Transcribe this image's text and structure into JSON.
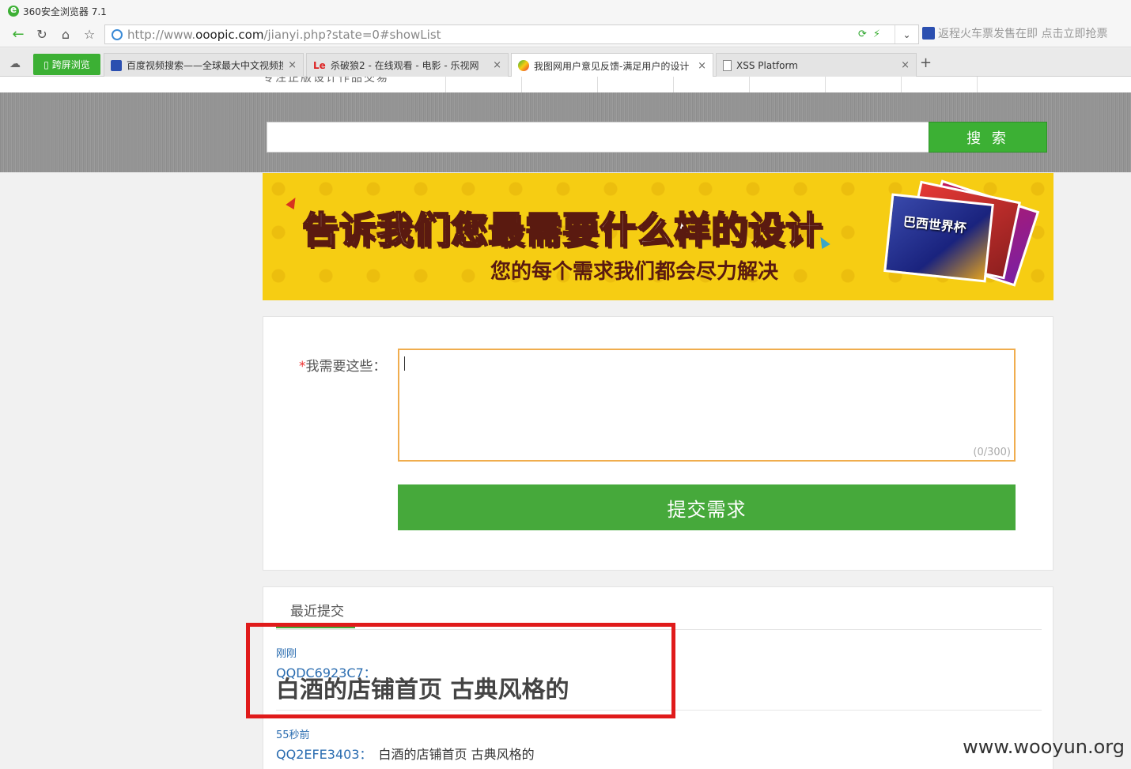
{
  "window": {
    "title": "360安全浏览器 7.1"
  },
  "navbar": {
    "url_prefix": "http://www.",
    "url_host": "ooopic.com",
    "url_path": "/jianyi.php?state=0#showList",
    "ad_text": "返程火车票发售在即 点击立即抢票"
  },
  "tabbar": {
    "special_tab": "跨屏浏览",
    "tabs": [
      {
        "title": "百度视频搜索——全球最大中文视频搜",
        "icon": "baidu-paw-icon"
      },
      {
        "title": "杀破狼2 - 在线观看 - 电影 - 乐视网",
        "icon": "letv-icon"
      },
      {
        "title": "我图网用户意见反馈-满足用户的设计",
        "icon": "ooopic-icon",
        "active": true
      },
      {
        "title": "XSS Platform",
        "icon": "page-icon"
      }
    ]
  },
  "page": {
    "top_strip_text": "专注正版设计作品交易",
    "search_button": "搜 索",
    "banner": {
      "title": "告诉我们您最需要什么样的设计",
      "subtitle": "您的每个需求我们都会尽力解决",
      "book_label": "巴西世界杯"
    },
    "form": {
      "required_mark": "*",
      "label": "我需要这些：",
      "textarea_value": "",
      "counter": "(0/300)",
      "submit": "提交需求"
    },
    "recent": {
      "tab_label": "最近提交",
      "entries": [
        {
          "time": "刚刚",
          "user": "QQDC6923C7：",
          "text": "白酒的店铺首页 古典风格的"
        },
        {
          "time": "55秒前",
          "user": "QQ2EFE3403：",
          "text": "白酒的店铺首页 古典风格的"
        }
      ]
    },
    "watermark": "www.wooyun.org"
  },
  "colors": {
    "brand_green": "#3cb034",
    "highlight_red": "#e01b1b",
    "banner_yellow": "#f6cd13",
    "link_blue": "#2a6cb0"
  }
}
